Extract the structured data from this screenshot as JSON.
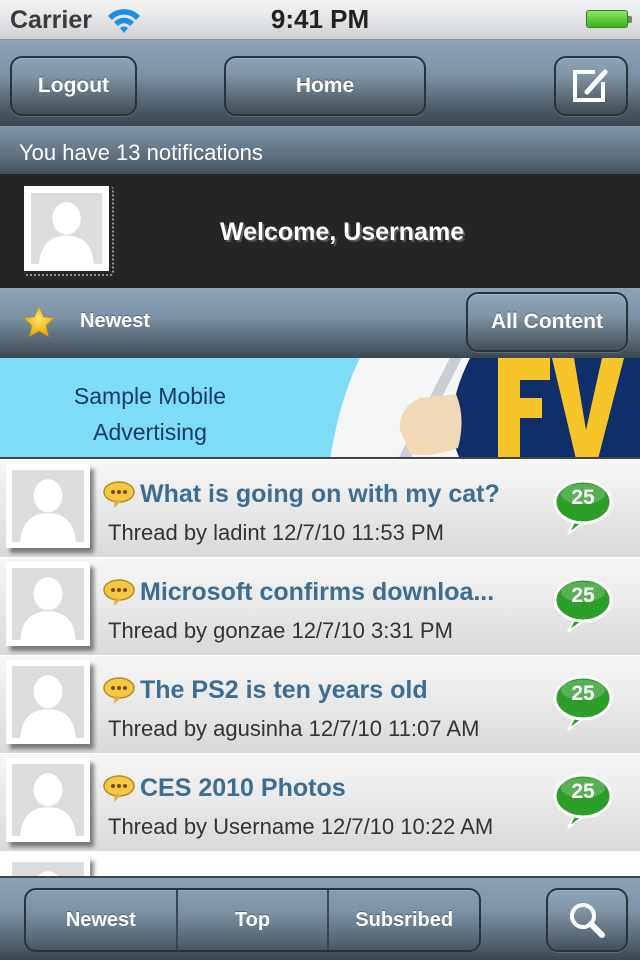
{
  "status_bar": {
    "carrier": "Carrier",
    "wifi_icon": "wifi-icon",
    "time": "9:41 PM",
    "battery_icon": "battery-full-icon"
  },
  "nav_bar": {
    "logout_label": "Logout",
    "home_label": "Home",
    "compose_icon": "compose-icon"
  },
  "notifications": {
    "text": "You have 13 notifications"
  },
  "welcome": {
    "text": "Welcome, Username",
    "avatar_icon": "default-avatar-icon"
  },
  "filter_bar": {
    "star_icon": "star-icon",
    "current_filter": "Newest",
    "content_button_label": "All Content"
  },
  "ad": {
    "line1": "Sample Mobile",
    "line2": "Advertising"
  },
  "threads": [
    {
      "title": "What is going on with my cat?",
      "meta": "Thread by ladint 12/7/10 11:53 PM",
      "replies": "25"
    },
    {
      "title": "Microsoft confirms downloa...",
      "meta": "Thread by gonzae 12/7/10 3:31 PM",
      "replies": "25"
    },
    {
      "title": "The PS2 is ten years old",
      "meta": "Thread by agusinha 12/7/10 11:07 AM",
      "replies": "25"
    },
    {
      "title": "CES 2010 Photos",
      "meta": "Thread by Username 12/7/10 10:22 AM",
      "replies": "25"
    }
  ],
  "tab_bar": {
    "tabs": [
      {
        "label": "Newest"
      },
      {
        "label": "Top"
      },
      {
        "label": "Subsribed"
      }
    ],
    "search_icon": "search-icon"
  },
  "colors": {
    "title_blue": "#3c6d93",
    "badge_green": "#2e9e2a",
    "ad_background": "#7fdcf6",
    "ad_text": "#143a70",
    "bar_blue_gray": "#7d93a5"
  }
}
